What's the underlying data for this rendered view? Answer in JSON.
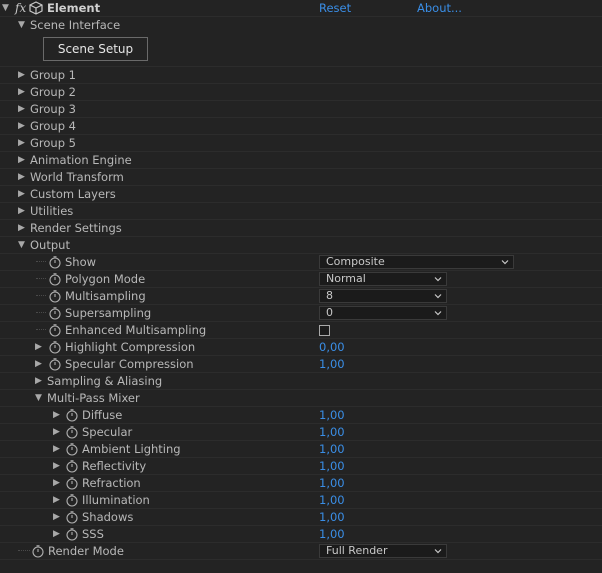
{
  "header": {
    "fx_label": "fx",
    "effect_name": "Element",
    "reset_label": "Reset",
    "about_label": "About..."
  },
  "scene_interface": {
    "label": "Scene Interface",
    "button_label": "Scene Setup"
  },
  "groups": [
    {
      "label": "Group 1"
    },
    {
      "label": "Group 2"
    },
    {
      "label": "Group 3"
    },
    {
      "label": "Group 4"
    },
    {
      "label": "Group 5"
    },
    {
      "label": "Animation Engine"
    },
    {
      "label": "World Transform"
    },
    {
      "label": "Custom Layers"
    },
    {
      "label": "Utilities"
    },
    {
      "label": "Render Settings"
    }
  ],
  "output": {
    "label": "Output",
    "show": {
      "label": "Show",
      "value": "Composite"
    },
    "polygon_mode": {
      "label": "Polygon Mode",
      "value": "Normal"
    },
    "multisampling": {
      "label": "Multisampling",
      "value": "8"
    },
    "supersampling": {
      "label": "Supersampling",
      "value": "0"
    },
    "enhanced_multisampling": {
      "label": "Enhanced Multisampling",
      "checked": false
    },
    "highlight_compression": {
      "label": "Highlight Compression",
      "value": "0,00"
    },
    "specular_compression": {
      "label": "Specular Compression",
      "value": "1,00"
    },
    "sampling_aliasing": {
      "label": "Sampling & Aliasing"
    },
    "multipass": {
      "label": "Multi-Pass Mixer",
      "items": [
        {
          "label": "Diffuse",
          "value": "1,00"
        },
        {
          "label": "Specular",
          "value": "1,00"
        },
        {
          "label": "Ambient Lighting",
          "value": "1,00"
        },
        {
          "label": "Reflectivity",
          "value": "1,00"
        },
        {
          "label": "Refraction",
          "value": "1,00"
        },
        {
          "label": "Illumination",
          "value": "1,00"
        },
        {
          "label": "Shadows",
          "value": "1,00"
        },
        {
          "label": "SSS",
          "value": "1,00"
        }
      ]
    }
  },
  "render_mode": {
    "label": "Render Mode",
    "value": "Full Render"
  },
  "colors": {
    "background": "#232323",
    "link_blue": "#3a8ee6",
    "text": "#b8b8b8"
  }
}
